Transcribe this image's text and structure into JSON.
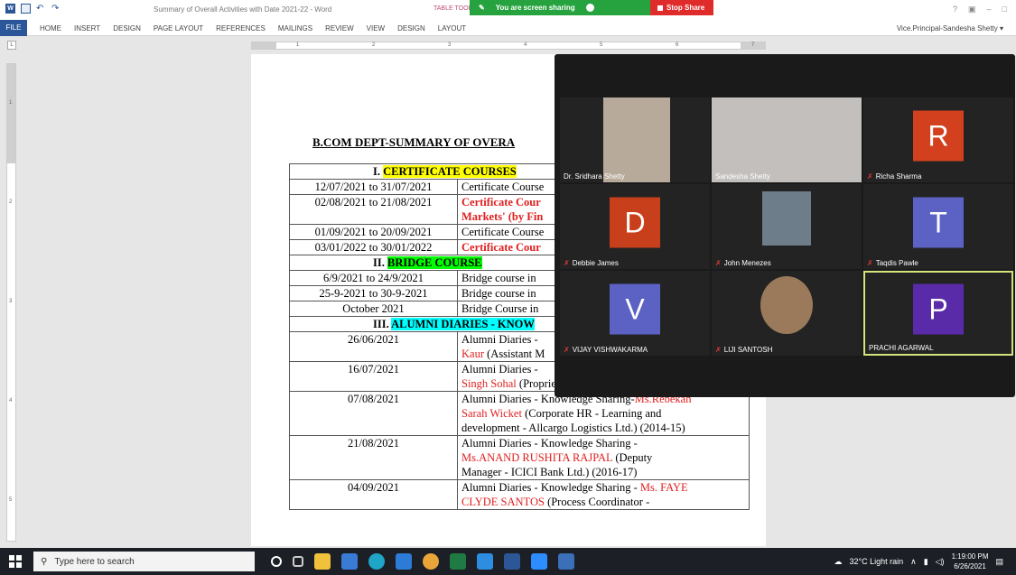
{
  "titlebar": {
    "doc_title": "Summary of Overall Activities with Date 2021-22 - Word",
    "table_tools": "TABLE TOOLS",
    "share_status": "You are screen sharing",
    "stop_share": "Stop Share",
    "help": "?",
    "minimize": "–",
    "maximize": "□"
  },
  "ribbon": {
    "file": "FILE",
    "tabs": [
      "HOME",
      "INSERT",
      "DESIGN",
      "PAGE LAYOUT",
      "REFERENCES",
      "MAILINGS",
      "REVIEW",
      "VIEW",
      "DESIGN",
      "LAYOUT"
    ],
    "user": "Vice.Principal-Sandesha Shetty ▾"
  },
  "ruler": {
    "tab_marker": "L",
    "numbers": [
      "1",
      "2",
      "3",
      "4",
      "5",
      "6",
      "7"
    ]
  },
  "vruler": {
    "numbers": [
      "1",
      "2",
      "3",
      "4",
      "5"
    ]
  },
  "document": {
    "heading": "B.COM DEPT-SUMMARY OF OVERA",
    "sections": {
      "certificate": {
        "num": "I.",
        "title": "CERTIFICATE COURSES"
      },
      "bridge": {
        "num": "II.",
        "title": "BRIDGE COURSE"
      },
      "alumni": {
        "num": "III.",
        "title": "ALUMNI DIARIES - KNOW"
      }
    },
    "certificate_rows": [
      {
        "date": "12/07/2021 to 31/07/2021",
        "text": "Certificate Course"
      },
      {
        "date": "02/08/2021 to 21/08/2021",
        "text": "Certificate Cour",
        "text2": "Markets' (by Fin"
      },
      {
        "date": "01/09/2021 to 20/09/2021",
        "text": "Certificate Course"
      },
      {
        "date": "03/01/2022 to 30/01/2022",
        "text": "Certificate Cour"
      }
    ],
    "bridge_rows": [
      {
        "date": "6/9/2021 to 24/9/2021",
        "text": "Bridge course in"
      },
      {
        "date": "25-9-2021 to 30-9-2021",
        "text": "Bridge course in"
      },
      {
        "date": "October 2021",
        "text": "Bridge Course in"
      }
    ],
    "alumni_rows": [
      {
        "date": "26/06/2021",
        "l1": "Alumni Diaries -",
        "l2_red": "Kaur",
        "l2": " (Assistant M"
      },
      {
        "date": "16/07/2021",
        "l1": "Alumni Diaries -",
        "l2_red": "Singh Sohal",
        "l2": " (Proprietor - Katraj Dairy)(2015-16)"
      },
      {
        "date": "07/08/2021",
        "l1": "Alumni Diaries - Knowledge Sharing-",
        "l1_red": "Ms.Rebekah",
        "l2_red": "Sarah Wicket",
        "l2": " (Corporate HR - Learning and",
        "l3": "development - Allcargo Logistics Ltd.) (2014-15)"
      },
      {
        "date": "21/08/2021",
        "l1": "Alumni Diaries - Knowledge Sharing -",
        "l2_red": "Ms.ANAND RUSHITA RAJPAL",
        "l2": " (Deputy",
        "l3": "Manager - ICICI Bank Ltd.) (2016-17)"
      },
      {
        "date": "04/09/2021",
        "l1": "Alumni Diaries - Knowledge Sharing - ",
        "l1_red": "Ms. FAYE",
        "l2_red": "CLYDE SANTOS",
        "l2": " (Process Coordinator -"
      }
    ]
  },
  "participants": [
    {
      "name": "Dr. Sridhara Shetty",
      "video": true,
      "muted": false
    },
    {
      "name": "Sandesha Shetty",
      "video": true,
      "muted": false
    },
    {
      "name": "Richa Sharma",
      "initial": "R",
      "color": "#d2401e",
      "muted": true
    },
    {
      "name": "Debbie James",
      "initial": "D",
      "color": "#c8401b",
      "muted": true
    },
    {
      "name": "John Menezes",
      "video": true,
      "muted": true
    },
    {
      "name": "Taqdis Pawle",
      "initial": "T",
      "color": "#5b62c4",
      "muted": true
    },
    {
      "name": "VIJAY VISHWAKARMA",
      "initial": "V",
      "color": "#5b62c4",
      "muted": true
    },
    {
      "name": "LIJI SANTOSH",
      "video": true,
      "muted": true
    },
    {
      "name": "PRACHI AGARWAL",
      "initial": "P",
      "color": "#5a2ba8",
      "muted": false,
      "active": true
    }
  ],
  "taskbar": {
    "search_placeholder": "Type here to search",
    "weather": "32°C  Light rain",
    "time": "1:19:00 PM",
    "date": "6/26/2021"
  }
}
